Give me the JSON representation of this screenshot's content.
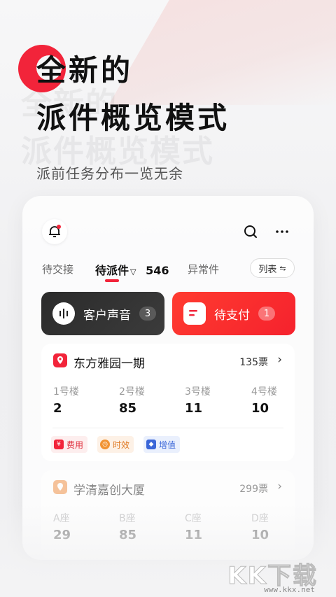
{
  "hero": {
    "title_line1": "全新的",
    "title_line2": "派件概览模式",
    "subtitle": "派前任务分布一览无余"
  },
  "accent_color": "#f2243a",
  "top_bar": {
    "bell_icon": "bell-icon",
    "search_icon": "search-icon",
    "more_icon": "more-icon"
  },
  "tabs": {
    "items": [
      {
        "label": "待交接"
      },
      {
        "label": "待派件",
        "count": "546"
      },
      {
        "label": "异常件"
      }
    ],
    "list_toggle": "列表"
  },
  "actions": {
    "voice": {
      "label": "客户声音",
      "count": "3"
    },
    "payment": {
      "label": "待支付",
      "count": "1"
    }
  },
  "projects": [
    {
      "name": "东方雅园一期",
      "count": "135票",
      "buildings": [
        {
          "name": "1号楼",
          "value": "2"
        },
        {
          "name": "2号楼",
          "value": "85"
        },
        {
          "name": "3号楼",
          "value": "11"
        },
        {
          "name": "4号楼",
          "value": "10"
        }
      ],
      "tags": [
        "费用",
        "时效",
        "增值"
      ]
    },
    {
      "name": "学清嘉创大厦",
      "count": "299票",
      "buildings": [
        {
          "name": "A座",
          "value": "29"
        },
        {
          "name": "B座",
          "value": "85"
        },
        {
          "name": "C座",
          "value": "11"
        },
        {
          "name": "D座",
          "value": "10"
        }
      ]
    }
  ],
  "watermark": {
    "logo": "KK下载",
    "url": "www.kkx.net"
  }
}
